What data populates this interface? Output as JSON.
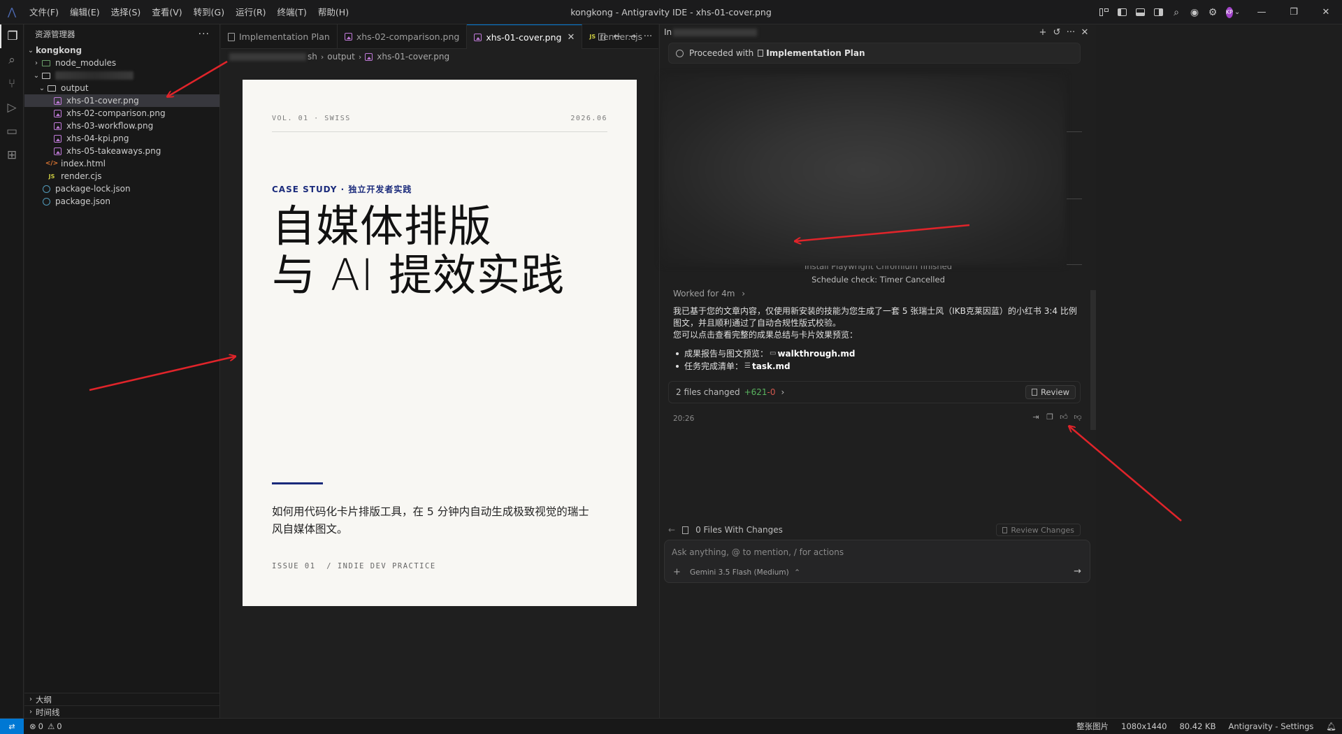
{
  "app": {
    "window_title": "kongkong - Antigravity IDE - xhs-01-cover.png",
    "menu": [
      "文件(F)",
      "编辑(E)",
      "选择(S)",
      "查看(V)",
      "转到(G)",
      "运行(R)",
      "终端(T)",
      "帮助(H)"
    ],
    "avatar_initials": "KP"
  },
  "sidebar": {
    "title": "资源管理器",
    "root": "kongkong",
    "tree": [
      {
        "label": "node_modules",
        "kind": "folder-green",
        "indent": 1,
        "chevron": "›"
      },
      {
        "label": "",
        "kind": "folder-blurred",
        "indent": 1,
        "chevron": "⌄"
      },
      {
        "label": "output",
        "kind": "folder",
        "indent": 2,
        "chevron": "⌄"
      },
      {
        "label": "xhs-01-cover.png",
        "kind": "image",
        "indent": 3,
        "selected": true
      },
      {
        "label": "xhs-02-comparison.png",
        "kind": "image",
        "indent": 3
      },
      {
        "label": "xhs-03-workflow.png",
        "kind": "image",
        "indent": 3
      },
      {
        "label": "xhs-04-kpi.png",
        "kind": "image",
        "indent": 3
      },
      {
        "label": "xhs-05-takeaways.png",
        "kind": "image",
        "indent": 3
      },
      {
        "label": "index.html",
        "kind": "html",
        "indent": 2
      },
      {
        "label": "render.cjs",
        "kind": "js",
        "indent": 2
      },
      {
        "label": "package-lock.json",
        "kind": "json",
        "indent": 1
      },
      {
        "label": "package.json",
        "kind": "json",
        "indent": 1
      }
    ],
    "bottom_sections": [
      "大纲",
      "时间线"
    ]
  },
  "editor": {
    "tabs": [
      {
        "label": "Implementation Plan",
        "icon": "doc"
      },
      {
        "label": "xhs-02-comparison.png",
        "icon": "image"
      },
      {
        "label": "xhs-01-cover.png",
        "icon": "image",
        "active": true
      },
      {
        "label": "render.cjs",
        "icon": "js"
      }
    ],
    "breadcrumb": [
      "sh",
      "output",
      "xhs-01-cover.png"
    ],
    "card": {
      "vol": "VOL. 01 · SWISS",
      "date": "2026.06",
      "kicker": "CASE STUDY · 独立开发者实践",
      "title_line1": "自媒体排版",
      "title_line2": "与 AI 提效实践",
      "subtitle": "如何用代码化卡片排版工具，在 5 分钟内自动生成极致视觉的瑞士风自媒体图文。",
      "issue": "ISSUE 01  / INDIE DEV PRACTICE",
      "accent_color": "#1a2a7a"
    }
  },
  "agent": {
    "header_prefix": "In",
    "proceeded_text": "Proceeded with",
    "proceeded_link": "Implementation Plan",
    "status_faded": "Install Playwright Chromium finished",
    "status_line": "Schedule check: Timer Cancelled",
    "worked_for": "Worked for 4m",
    "message_line1": "我已基于您的文章内容，仅使用新安装的技能为您生成了一套 5 张瑞士风（IKB克莱因蓝）的小红书 3:4 比例图文，并且顺利通过了自动合规性版式校验。",
    "message_line2": "您可以点击查看完整的成果总结与卡片效果预览：",
    "list": [
      {
        "label": "成果报告与图文预览：",
        "link": "walkthrough.md"
      },
      {
        "label": "任务完成清单：",
        "link": "task.md"
      }
    ],
    "files_changed": "2 files changed",
    "additions": "+621",
    "deletions": "-0",
    "review_label": "Review",
    "timestamp": "20:26",
    "changes_bar_label": "0 Files With Changes",
    "review_changes_label": "Review Changes",
    "chat_placeholder": "Ask anything, @ to mention, / for actions",
    "model": "Gemini 3.5 Flash (Medium)"
  },
  "statusbar": {
    "errors": "0",
    "warnings": "0",
    "view_mode": "整张图片",
    "dimensions": "1080x1440",
    "file_size": "80.42 KB",
    "settings": "Antigravity - Settings"
  }
}
